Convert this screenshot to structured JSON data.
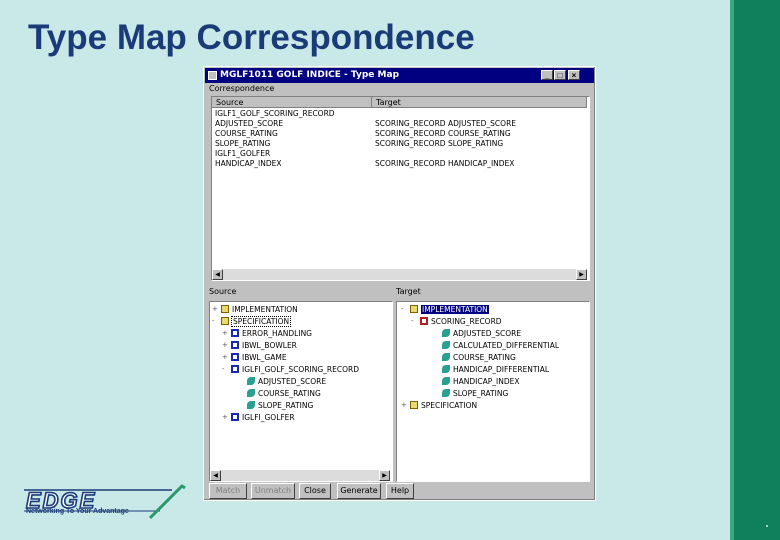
{
  "slide": {
    "title": "Type Map Correspondence"
  },
  "logo": {
    "brand": "EDGE",
    "tagline": "Networking To Your Advantage"
  },
  "window": {
    "title": "MGLF1011  GOLF  INDICE - Type Map",
    "controls": {
      "minimize": "_",
      "maximize": "□",
      "close": "×"
    }
  },
  "correspondence": {
    "label": "Correspondence",
    "col_source": "Source",
    "col_target": "Target",
    "rows": [
      {
        "source": "IGLF1_GOLF_SCORING_RECORD",
        "target": ""
      },
      {
        "source": "   ADJUSTED_SCORE",
        "target": "SCORING_RECORD  ADJUSTED_SCORE"
      },
      {
        "source": "   COURSE_RATING",
        "target": "SCORING_RECORD  COURSE_RATING"
      },
      {
        "source": "   SLOPE_RATING",
        "target": "SCORING_RECORD  SLOPE_RATING"
      },
      {
        "source": "IGLF1_GOLFER",
        "target": ""
      },
      {
        "source": "   HANDICAP_INDEX",
        "target": "SCORING_RECORD  HANDICAP_INDEX"
      }
    ]
  },
  "source_panel": {
    "label": "Source",
    "items": [
      {
        "text": "IMPLEMENTATION",
        "expander": "+",
        "icon": "folder"
      },
      {
        "text": "SPECIFICATION",
        "expander": "-",
        "icon": "folder"
      },
      {
        "text": "ERROR_HANDLING",
        "expander": "+",
        "icon": "table"
      },
      {
        "text": "IBWL_BOWLER",
        "expander": "+",
        "icon": "table"
      },
      {
        "text": "IBWL_GAME",
        "expander": "+",
        "icon": "table"
      },
      {
        "text": "IGLFI_GOLF_SCORING_RECORD",
        "expander": "-",
        "icon": "table"
      },
      {
        "text": "ADJUSTED_SCORE",
        "expander": "",
        "icon": "field"
      },
      {
        "text": "COURSE_RATING",
        "expander": "",
        "icon": "field"
      },
      {
        "text": "SLOPE_RATING",
        "expander": "",
        "icon": "field"
      },
      {
        "text": "IGLFI_GOLFER",
        "expander": "+",
        "icon": "table"
      }
    ]
  },
  "target_panel": {
    "label": "Target",
    "items": [
      {
        "text": "IMPLEMENTATION",
        "expander": "-",
        "icon": "folder"
      },
      {
        "text": "SCORING_RECORD",
        "expander": "-",
        "icon": "rtable"
      },
      {
        "text": "ADJUSTED_SCORE",
        "expander": "",
        "icon": "field"
      },
      {
        "text": "CALCULATED_DIFFERENTIAL",
        "expander": "",
        "icon": "field"
      },
      {
        "text": "COURSE_RATING",
        "expander": "",
        "icon": "field"
      },
      {
        "text": "HANDICAP_DIFFERENTIAL",
        "expander": "",
        "icon": "field"
      },
      {
        "text": "HANDICAP_INDEX",
        "expander": "",
        "icon": "field"
      },
      {
        "text": "SLOPE_RATING",
        "expander": "",
        "icon": "field"
      },
      {
        "text": "SPECIFICATION",
        "expander": "+",
        "icon": "folder"
      }
    ]
  },
  "buttons": {
    "match": "Match",
    "unmatch": "Unmatch",
    "close": "Close",
    "generate": "Generate",
    "help": "Help"
  },
  "colors": {
    "background": "#c9e8e8",
    "title": "#1a3a78",
    "accent_bar": "#0f7f5c",
    "titlebar": "#000080"
  }
}
